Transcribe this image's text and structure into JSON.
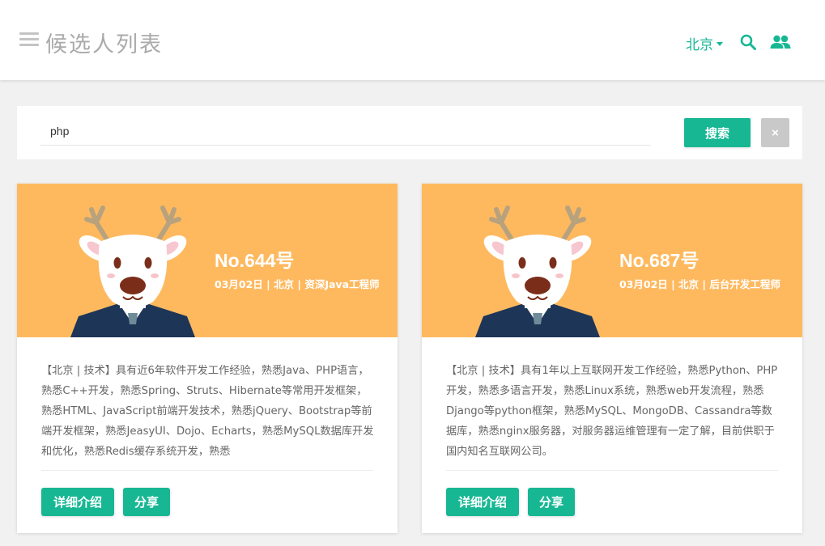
{
  "header": {
    "title": "候选人列表",
    "city": "北京",
    "accent_color": "#17b794"
  },
  "search": {
    "value": "php",
    "button_label": "搜索",
    "clear_label": "×"
  },
  "cards": [
    {
      "number": "No.644号",
      "meta": "03月02日 | 北京 | 资深Java工程师",
      "description": "【北京 | 技术】具有近6年软件开发工作经验，熟悉Java、PHP语言，熟悉C++开发，熟悉Spring、Struts、Hibernate等常用开发框架，熟悉HTML、JavaScript前端开发技术，熟悉jQuery、Bootstrap等前端开发框架，熟悉JeasyUI、Dojo、Echarts，熟悉MySQL数据库开发和优化，熟悉Redis缓存系统开发，熟悉",
      "detail_label": "详细介绍",
      "share_label": "分享"
    },
    {
      "number": "No.687号",
      "meta": "03月02日 | 北京 | 后台开发工程师",
      "description": "【北京 | 技术】具有1年以上互联网开发工作经验，熟悉Python、PHP开发，熟悉多语言开发，熟悉Linux系统，熟悉web开发流程，熟悉Django等python框架，熟悉MySQL、MongoDB、Cassandra等数据库，熟悉nginx服务器，对服务器运维管理有一定了解，目前供职于国内知名互联网公司。",
      "detail_label": "详细介绍",
      "share_label": "分享"
    }
  ]
}
